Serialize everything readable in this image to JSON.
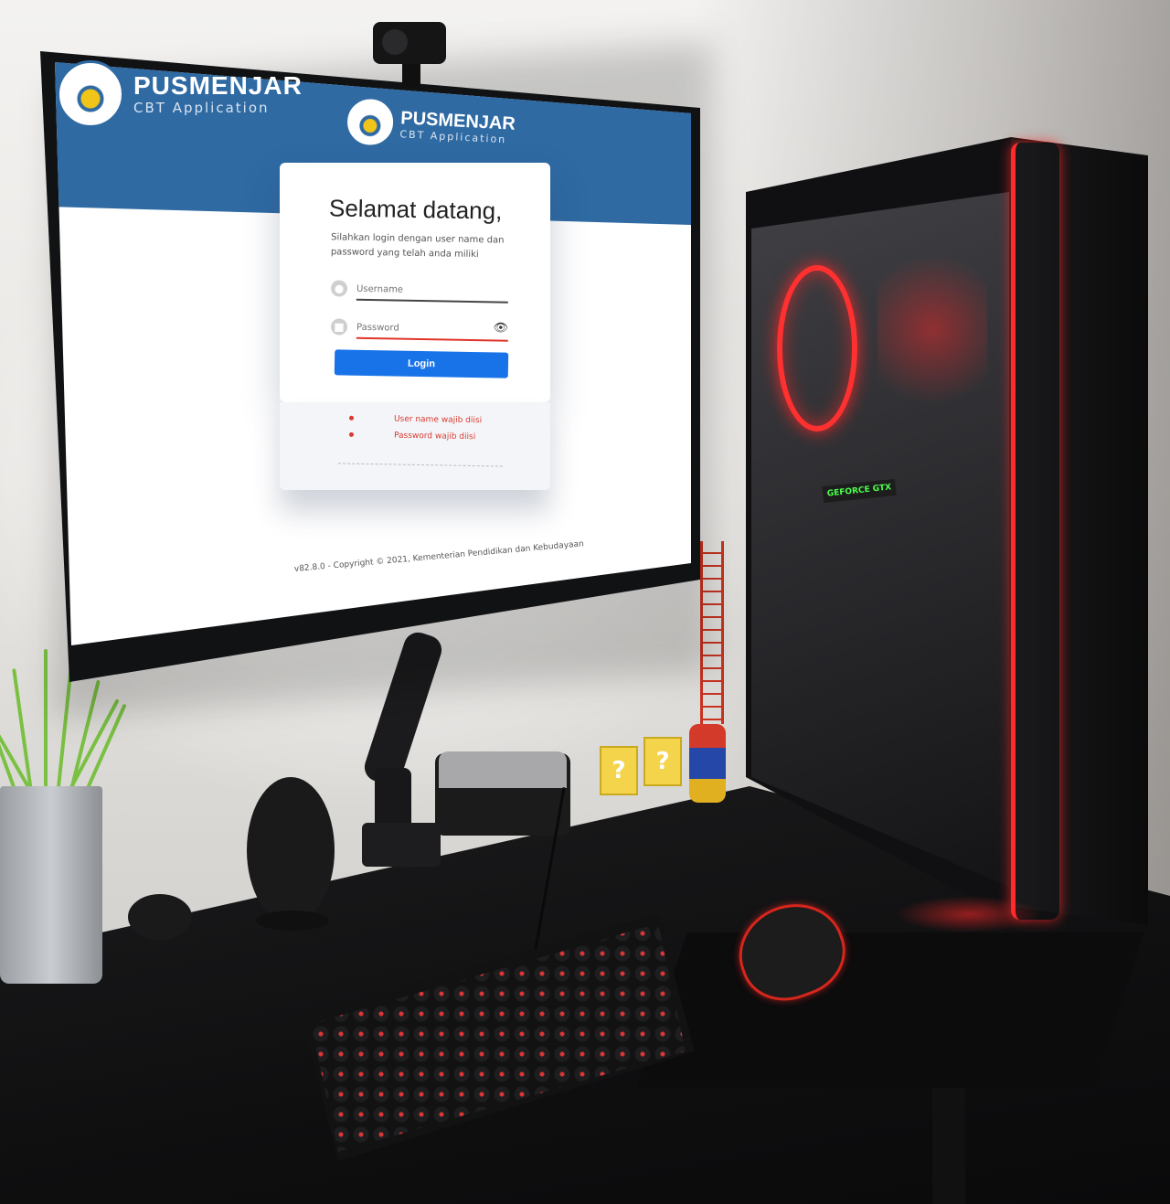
{
  "app": {
    "brand_name": "PUSMENJAR",
    "brand_subtitle": "CBT Application"
  },
  "login_card": {
    "welcome_title": "Selamat datang,",
    "instruction": "Silahkan login dengan user name dan password yang telah anda miliki",
    "username_placeholder": "Username",
    "password_placeholder": "Password",
    "login_button": "Login"
  },
  "validation_errors": [
    "User name wajib diisi",
    "Password wajib diisi"
  ],
  "footer": {
    "text": "v82.8.0 - Copyright © 2021, Kementerian Pendidikan dan Kebudayaan"
  },
  "hardware": {
    "gpu_label": "GEFORCE GTX",
    "question_mark": "?"
  },
  "colors": {
    "brand_blue": "#2f6aa3",
    "button_blue": "#1973e8",
    "error_red": "#d73a30",
    "case_led_red": "#ff2a2a"
  },
  "icons": {
    "username": "user-icon",
    "password": "lock-icon",
    "toggle_password": "eye-icon",
    "logo": "tut-wuri-handayani-emblem"
  }
}
